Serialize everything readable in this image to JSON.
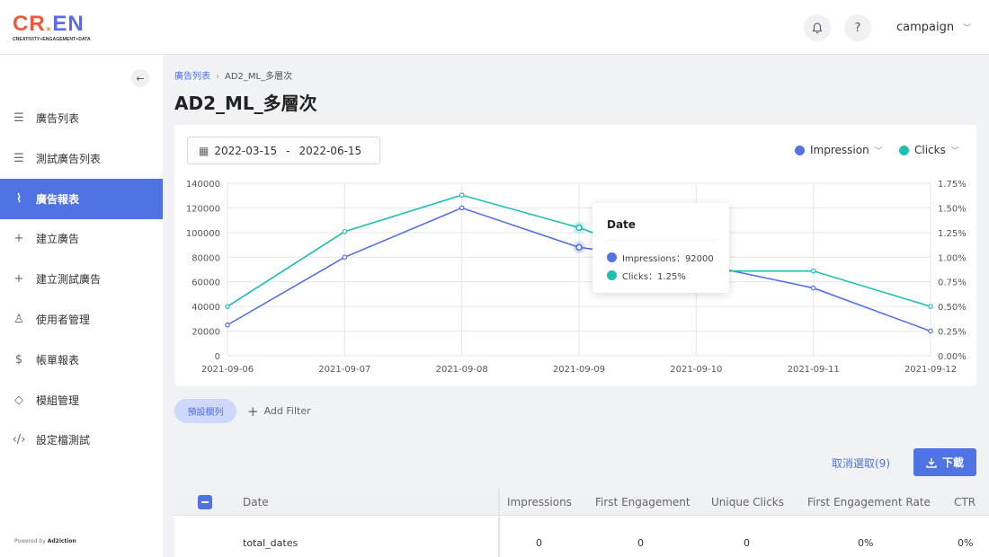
{
  "app": {
    "logo_main_c": "CR",
    "logo_main_dot": ".",
    "logo_main_e": "EN",
    "logo_sub": "CREATIVITY+ENGAGEMENT+DATA",
    "user": "campaign",
    "bell_icon": "bell-icon",
    "help_glyph": "?"
  },
  "sidebar": {
    "items": [
      {
        "label": "廣告列表",
        "icon": "list-icon",
        "glyph": "☰"
      },
      {
        "label": "測試廣告列表",
        "icon": "list-test-icon",
        "glyph": "☰"
      },
      {
        "label": "廣告報表",
        "icon": "report-icon",
        "glyph": "⌇"
      },
      {
        "label": "建立廣告",
        "icon": "plus-icon",
        "glyph": "+"
      },
      {
        "label": "建立測試廣告",
        "icon": "plus-test-icon",
        "glyph": "+"
      },
      {
        "label": "使用者管理",
        "icon": "user-icon",
        "glyph": "♙"
      },
      {
        "label": "帳單報表",
        "icon": "dollar-icon",
        "glyph": "$"
      },
      {
        "label": "模組管理",
        "icon": "cube-icon",
        "glyph": "◇"
      },
      {
        "label": "設定檔測試",
        "icon": "code-icon",
        "glyph": "‹/›"
      }
    ],
    "active_index": 2,
    "powered_prefix": "Powered by",
    "powered_brand": "Ad2iction"
  },
  "breadcrumb": {
    "root": "廣告列表",
    "current": "AD2_ML_多層次"
  },
  "page_title": "AD2_ML_多層次",
  "date_range": {
    "start": "2022-03-15",
    "separator": "-",
    "end": "2022-06-15"
  },
  "metric_selectors": [
    {
      "label": "Impression",
      "color": "#5470e5"
    },
    {
      "label": "Clicks",
      "color": "#1fbfb2"
    }
  ],
  "chart_data": {
    "type": "line",
    "x": [
      "2021-09-06",
      "2021-09-07",
      "2021-09-08",
      "2021-09-09",
      "2021-09-10",
      "2021-09-11",
      "2021-09-12"
    ],
    "series": [
      {
        "name": "Impressions",
        "axis": "left",
        "color": "#5470e5",
        "values": [
          25000,
          80000,
          120000,
          88000,
          75000,
          55000,
          20000
        ]
      },
      {
        "name": "Clicks",
        "axis": "right",
        "color": "#1fbfb2",
        "values": [
          0.5,
          1.26,
          1.63,
          1.3,
          0.86,
          0.86,
          0.5
        ]
      }
    ],
    "y_left_ticks": [
      "140000",
      "120000",
      "100000",
      "80000",
      "60000",
      "40000",
      "20000",
      "0"
    ],
    "y_right_ticks": [
      "1.75%",
      "1.50%",
      "1.25%",
      "1.00%",
      "0.75%",
      "0.50%",
      "0.25%",
      "0.00%"
    ],
    "ylim_left": [
      0,
      140000
    ],
    "ylim_right": [
      0,
      1.75
    ],
    "grid": true,
    "tooltip": {
      "title": "Date",
      "index": 3,
      "rows": [
        {
          "text": "Impressions：92000",
          "color": "#5470e5"
        },
        {
          "text": "Clicks：1.25%",
          "color": "#1fbfb2"
        }
      ]
    }
  },
  "filters": {
    "preset_label": "預設欄列",
    "add_label": "Add Filter"
  },
  "actions": {
    "cancel_selection": "取消選取(9)",
    "download": "下載"
  },
  "table": {
    "columns": [
      "Date",
      "Impressions",
      "First Engagement",
      "Unique Clicks",
      "First Engagement Rate",
      "CTR"
    ],
    "rows": [
      [
        "total_dates",
        "0",
        "0",
        "0",
        "0%",
        "0%"
      ]
    ]
  }
}
